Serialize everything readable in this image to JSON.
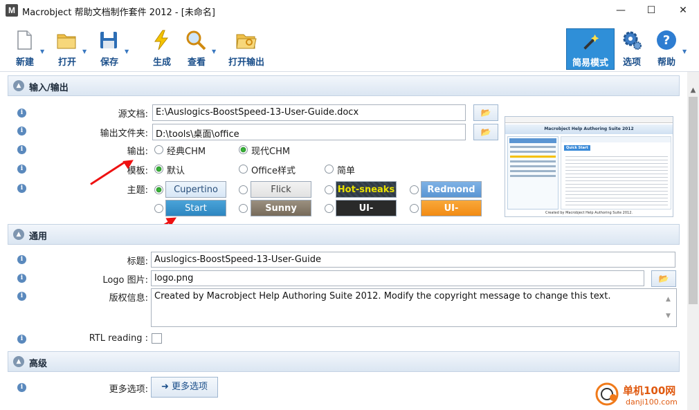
{
  "window": {
    "title": "Macrobject 帮助文档制作套件 2012 - [未命名]",
    "app_icon_letter": "M",
    "minimize": "—",
    "maximize": "☐",
    "close": "✕"
  },
  "toolbar": {
    "new": "新建",
    "open": "打开",
    "save": "保存",
    "generate": "生成",
    "view": "查看",
    "open_output": "打开输出",
    "easy_mode": "简易模式",
    "options": "选项",
    "help": "帮助"
  },
  "sections": {
    "io": "输入/输出",
    "general": "通用",
    "advanced": "高级"
  },
  "io": {
    "source_label": "源文档:",
    "source_value": "E:\\Auslogics-BoostSpeed-13-User-Guide.docx",
    "output_folder_label": "输出文件夹:",
    "output_folder_value": "D:\\tools\\桌面\\office",
    "output_label": "输出:",
    "output_options": [
      "经典CHM",
      "现代CHM"
    ],
    "output_selected": "现代CHM",
    "template_label": "模板:",
    "template_options": [
      "默认",
      "Office样式",
      "简单"
    ],
    "template_selected": "默认",
    "theme_label": "主题:",
    "themes": [
      "Cupertino",
      "Flick",
      "Hot-sneaks",
      "Redmond",
      "Start",
      "Sunny",
      "UI-darkness",
      "UI-lightness"
    ],
    "theme_selected": "Cupertino"
  },
  "preview": {
    "title": "Macrobject Help Authoring Suite 2012",
    "heading": "Quick Start",
    "footer": "Created by Macrobject Help Authoring Suite 2012."
  },
  "general": {
    "title_label": "标题:",
    "title_value": "Auslogics-BoostSpeed-13-User-Guide",
    "logo_label": "Logo 图片:",
    "logo_value": "logo.png",
    "copyright_label": "版权信息:",
    "copyright_value": "Created by Macrobject Help Authoring Suite 2012. Modify the copyright message to change this text.",
    "rtl_label": "RTL reading :"
  },
  "advanced": {
    "more_label": "更多选项:",
    "more_button": "更多选项"
  },
  "watermark": {
    "text": "单机100网",
    "url": "danji100.com"
  },
  "colors": {
    "accent": "#1b4f8a",
    "section_bg": "#dbe6f2",
    "easy_mode_bg": "#2f8fd8",
    "arrow": "#e11111"
  }
}
